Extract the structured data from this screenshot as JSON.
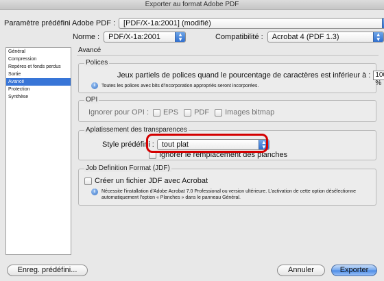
{
  "window": {
    "title": "Exporter au format Adobe PDF"
  },
  "header": {
    "preset_label": "Paramètre prédéfini Adobe PDF :",
    "preset_value": "[PDF/X-1a:2001] (modifié)",
    "standard_label": "Norme :",
    "standard_value": "PDF/X-1a:2001",
    "compat_label": "Compatibilité :",
    "compat_value": "Acrobat 4 (PDF 1.3)"
  },
  "sidebar": {
    "items": [
      {
        "label": "Général"
      },
      {
        "label": "Compression"
      },
      {
        "label": "Repères et fonds perdus"
      },
      {
        "label": "Sortie"
      },
      {
        "label": "Avancé"
      },
      {
        "label": "Protection"
      },
      {
        "label": "Synthèse"
      }
    ],
    "selected": "Avancé"
  },
  "panel": {
    "title": "Avancé",
    "fonts": {
      "title": "Polices",
      "subset_label": "Jeux partiels de polices quand le pourcentage de caractères est inférieur à :",
      "subset_value": "100 %",
      "note": "Toutes les polices avec bits d'incorporation appropriés seront incorporées."
    },
    "opi": {
      "title": "OPI",
      "omit_label": "Ignorer pour OPI :",
      "options": [
        "EPS",
        "PDF",
        "Images bitmap"
      ]
    },
    "flattening": {
      "title": "Aplatissement des transparences",
      "style_label": "Style prédéfini :",
      "style_value": "tout plat",
      "ignore_label": "Ignorer le remplacement des planches"
    },
    "jdf": {
      "title": "Job Definition Format (JDF)",
      "create_label": "Créer un fichier JDF avec Acrobat",
      "note_line1": "Nécessite l'installation d'Adobe Acrobat 7.0 Professional ou version ultérieure. L'activation de cette option désélectionne",
      "note_line2": "automatiquement l'option « Planches » dans le panneau Général."
    }
  },
  "footer": {
    "save_preset": "Enreg. prédéfini...",
    "cancel": "Annuler",
    "export": "Exporter"
  },
  "colors": {
    "selection": "#3875d7",
    "highlight": "#d40000",
    "default_button": "#4a8ae6"
  }
}
